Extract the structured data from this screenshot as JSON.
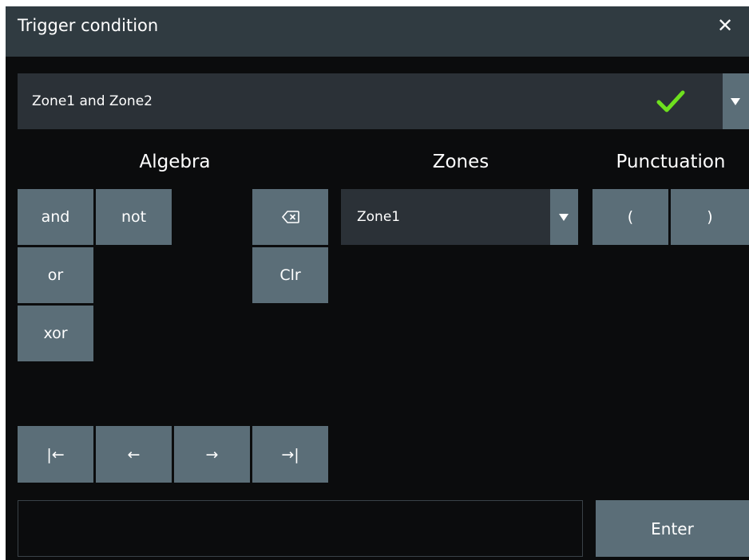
{
  "dialog": {
    "title": "Trigger condition",
    "close_icon": "close-icon"
  },
  "condition": {
    "value": "Zone1 and Zone2",
    "valid_icon": "checkmark-icon",
    "valid_color": "#6ee01e"
  },
  "algebra": {
    "heading": "Algebra",
    "and": "and",
    "not": "not",
    "or": "or",
    "xor": "xor",
    "backspace_icon": "backspace-icon",
    "clear": "Clr"
  },
  "zones": {
    "heading": "Zones",
    "selected": "Zone1"
  },
  "punctuation": {
    "heading": "Punctuation",
    "open_paren": "(",
    "close_paren": ")"
  },
  "cursor": {
    "home": "|←",
    "left": "←",
    "right": "→",
    "end": "→|"
  },
  "input": {
    "value": ""
  },
  "enter": "Enter",
  "colors": {
    "dialog_bg": "#0b0c0d",
    "titlebar": "#303b41",
    "button": "#5b6e78",
    "field": "#2b3137"
  }
}
